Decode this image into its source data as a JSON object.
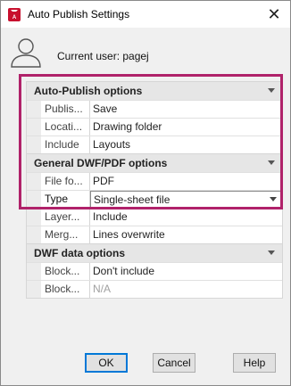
{
  "window": {
    "title": "Auto Publish Settings",
    "app_icon_text": "A",
    "close_glyph": "✕"
  },
  "user": {
    "label": "Current user: pagej"
  },
  "sections": [
    {
      "title": "Auto-Publish options",
      "rows": [
        {
          "name": "Publis...",
          "value": "Save"
        },
        {
          "name": "Locati...",
          "value": "Drawing folder"
        },
        {
          "name": "Include",
          "value": "Layouts"
        }
      ]
    },
    {
      "title": "General DWF/PDF options",
      "rows": [
        {
          "name": "File fo...",
          "value": "PDF"
        },
        {
          "name": "Type",
          "value": "Single-sheet file",
          "dropdown": true,
          "selected": true
        },
        {
          "name": "Layer...",
          "value": "Include"
        },
        {
          "name": "Merg...",
          "value": "Lines overwrite"
        }
      ]
    },
    {
      "title": "DWF data options",
      "rows": [
        {
          "name": "Block...",
          "value": "Don't include"
        },
        {
          "name": "Block...",
          "value": "N/A",
          "disabled": true
        }
      ]
    }
  ],
  "buttons": {
    "ok": "OK",
    "cancel": "Cancel",
    "help": "Help"
  },
  "colors": {
    "highlight": "#b0226a",
    "brand": "#c8102e"
  }
}
